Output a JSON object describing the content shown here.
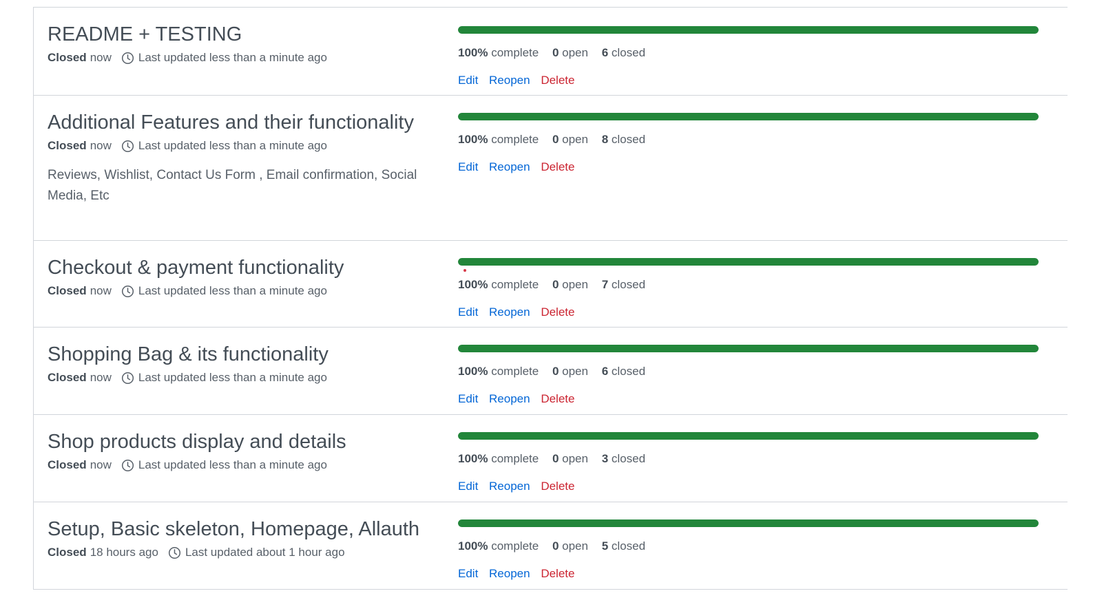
{
  "colors": {
    "progress": "#22863a",
    "link": "#0366d6",
    "danger": "#cb2431"
  },
  "milestones": [
    {
      "title": "README + TESTING",
      "status_label": "Closed",
      "status_time": "now",
      "updated": "Last updated less than a minute ago",
      "description": "",
      "progress": 1.0,
      "percent": "100%",
      "complete_label": "complete",
      "open_count": "0",
      "open_label": "open",
      "closed_count": "6",
      "closed_label": "closed",
      "edit": "Edit",
      "reopen": "Reopen",
      "delete": "Delete"
    },
    {
      "title": "Additional Features and their functionality",
      "status_label": "Closed",
      "status_time": "now",
      "updated": "Last updated less than a minute ago",
      "description": "Reviews, Wishlist, Contact Us Form , Email confirmation, Social Media, Etc",
      "progress": 1.0,
      "percent": "100%",
      "complete_label": "complete",
      "open_count": "0",
      "open_label": "open",
      "closed_count": "8",
      "closed_label": "closed",
      "edit": "Edit",
      "reopen": "Reopen",
      "delete": "Delete"
    },
    {
      "title": "Checkout & payment functionality",
      "status_label": "Closed",
      "status_time": "now",
      "updated": "Last updated less than a minute ago",
      "description": "",
      "progress": 1.0,
      "percent": "100%",
      "complete_label": "complete",
      "open_count": "0",
      "open_label": "open",
      "closed_count": "7",
      "closed_label": "closed",
      "edit": "Edit",
      "reopen": "Reopen",
      "delete": "Delete"
    },
    {
      "title": "Shopping Bag & its functionality",
      "status_label": "Closed",
      "status_time": "now",
      "updated": "Last updated less than a minute ago",
      "description": "",
      "progress": 1.0,
      "percent": "100%",
      "complete_label": "complete",
      "open_count": "0",
      "open_label": "open",
      "closed_count": "6",
      "closed_label": "closed",
      "edit": "Edit",
      "reopen": "Reopen",
      "delete": "Delete"
    },
    {
      "title": "Shop products display and details",
      "status_label": "Closed",
      "status_time": "now",
      "updated": "Last updated less than a minute ago",
      "description": "",
      "progress": 1.0,
      "percent": "100%",
      "complete_label": "complete",
      "open_count": "0",
      "open_label": "open",
      "closed_count": "3",
      "closed_label": "closed",
      "edit": "Edit",
      "reopen": "Reopen",
      "delete": "Delete"
    },
    {
      "title": "Setup, Basic skeleton, Homepage, Allauth",
      "status_label": "Closed",
      "status_time": "18 hours ago",
      "updated": "Last updated about 1 hour ago",
      "description": "",
      "progress": 1.0,
      "percent": "100%",
      "complete_label": "complete",
      "open_count": "0",
      "open_label": "open",
      "closed_count": "5",
      "closed_label": "closed",
      "edit": "Edit",
      "reopen": "Reopen",
      "delete": "Delete"
    }
  ]
}
